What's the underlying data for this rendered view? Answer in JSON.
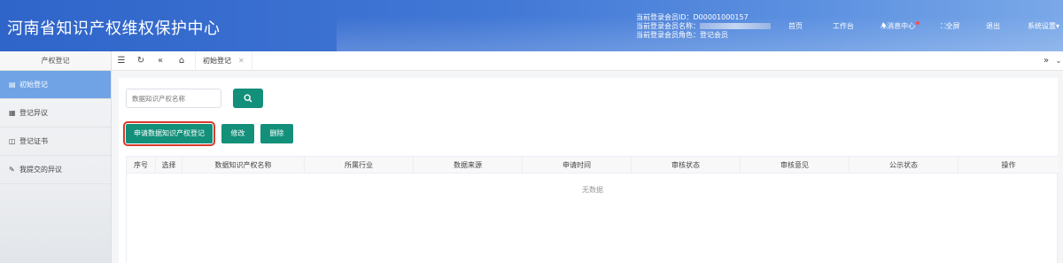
{
  "header": {
    "title": "河南省知识产权维权保护中心",
    "user_id_line": "当前登录会员ID：D00001000157",
    "user_name_label": "当前登录会员名称：",
    "user_role_line": "当前登录会员角色：登记会员",
    "nav": {
      "home": "首页",
      "workbench": "工作台",
      "messages": "消息中心",
      "fullscreen": "全屏",
      "logout": "退出",
      "settings": "系统设置"
    }
  },
  "sidebar": {
    "title": "产权登记",
    "items": [
      {
        "label": "初始登记",
        "icon": "document-icon"
      },
      {
        "label": "登记异议",
        "icon": "objection-icon"
      },
      {
        "label": "登记证书",
        "icon": "certificate-icon"
      },
      {
        "label": "我提交的异议",
        "icon": "pencil-icon"
      }
    ]
  },
  "tabbar": {
    "active_tab": "初始登记"
  },
  "main": {
    "search_placeholder": "数据知识产权名称",
    "apply_button": "申请数据知识产权登记",
    "edit_button": "修改",
    "delete_button": "删除",
    "columns": [
      "序号",
      "选择",
      "数据知识产权名称",
      "所属行业",
      "数据来源",
      "申请时间",
      "审核状态",
      "审核意见",
      "公示状态",
      "操作"
    ],
    "empty_text": "无数据"
  },
  "colors": {
    "primary": "#13907a",
    "header_blue": "#3a6fd0",
    "active_sidebar": "#6fa3e6",
    "highlight_outline": "#d9392c"
  }
}
